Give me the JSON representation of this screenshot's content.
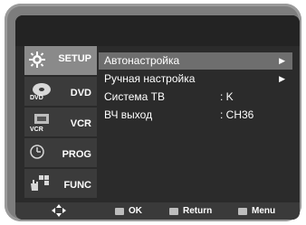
{
  "sidebar": {
    "items": [
      {
        "label": "SETUP",
        "icon": "gear-icon"
      },
      {
        "label": "DVD",
        "icon": "dvd-icon"
      },
      {
        "label": "VCR",
        "icon": "vcr-icon"
      },
      {
        "label": "PROG",
        "icon": "clock-icon"
      },
      {
        "label": "FUNC",
        "icon": "hand-icon"
      }
    ]
  },
  "menu": {
    "rows": [
      {
        "name": "Автонастройка",
        "value": "",
        "arrow": "▶"
      },
      {
        "name": "Ручная настройка",
        "value": "",
        "arrow": "▶"
      },
      {
        "name": "Система ТВ",
        "value": ": K",
        "arrow": ""
      },
      {
        "name": "ВЧ выход",
        "value": ": CH36",
        "arrow": ""
      }
    ]
  },
  "footer": {
    "ok_label": "OK",
    "return_label": "Return",
    "menu_label": "Menu"
  },
  "colors": {
    "bezel": "#7d7d7d",
    "screen": "#2b2b2b",
    "active_tab": "#8a8a8a",
    "selected_row": "#6e6e6e"
  }
}
